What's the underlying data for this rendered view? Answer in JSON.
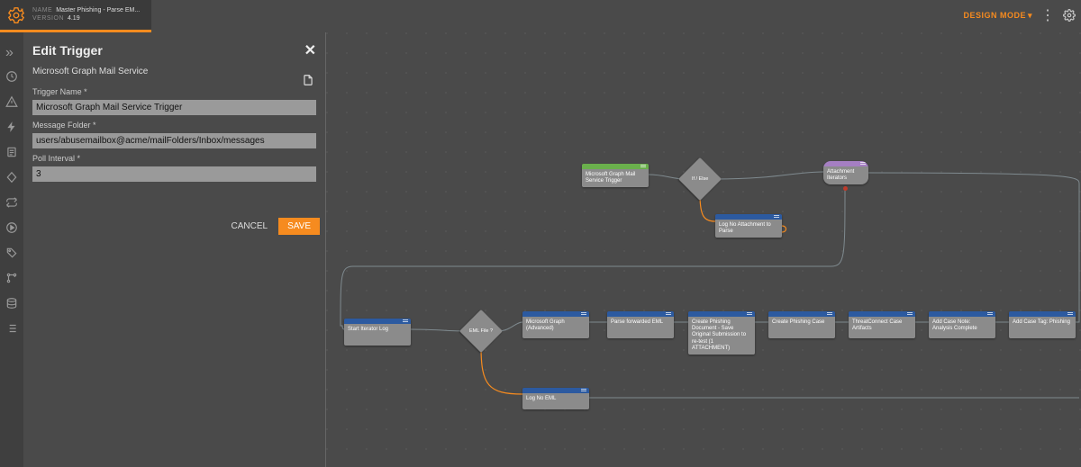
{
  "header": {
    "name_label": "NAME",
    "name_value": "Master Phishing - Parse EM...",
    "version_label": "VERSION",
    "version_value": "4.19"
  },
  "topRight": {
    "design_mode": "DESIGN MODE"
  },
  "panel": {
    "title": "Edit Trigger",
    "subtitle": "Microsoft Graph Mail Service",
    "fields": {
      "trigger_name_label": "Trigger Name *",
      "trigger_name_value": "Microsoft Graph Mail Service Trigger",
      "message_folder_label": "Message Folder *",
      "message_folder_value": "users/abusemailbox@acme/mailFolders/Inbox/messages",
      "poll_interval_label": "Poll Interval *",
      "poll_interval_value": "3"
    },
    "actions": {
      "cancel": "CANCEL",
      "save": "SAVE"
    }
  },
  "rail_icons": [
    "expand",
    "clock",
    "warning",
    "bolt",
    "notes",
    "diamond",
    "loop",
    "play",
    "tag",
    "branch",
    "database",
    "list"
  ],
  "zoom_icons": [
    "zoom-in",
    "zoom-out",
    "fullscreen"
  ],
  "tool_icons": [
    "cube",
    "move",
    "copy",
    "trash",
    "eye",
    "toggle",
    "fit",
    "expand"
  ],
  "nodes": {
    "trigger": {
      "label": "Microsoft Graph Mail Service Trigger"
    },
    "ifelse": {
      "label": "If / Else"
    },
    "logNoAtt": {
      "label": "Log No Attachment to Parse"
    },
    "iterators": {
      "label": "Attachment Iterators"
    },
    "startIter": {
      "label": "Start Iterator Log"
    },
    "emlFile": {
      "label": "EML File ?"
    },
    "msgraph": {
      "label": "Microsoft Graph (Advanced)"
    },
    "parseEml": {
      "label": "Parse forwarded EML"
    },
    "createDoc": {
      "label": "Create Phishing Document - Save Original Submission to re-test (1 ATTACHMENT)"
    },
    "createCase": {
      "label": "Create Phishing Case"
    },
    "tcArtifacts": {
      "label": "ThreatConnect Case Artifacts"
    },
    "addNote": {
      "label": "Add Case Note: Analysis Complete"
    },
    "addTag": {
      "label": "Add Case Tag: Phishing"
    },
    "logNoEml": {
      "label": "Log No EML"
    }
  }
}
